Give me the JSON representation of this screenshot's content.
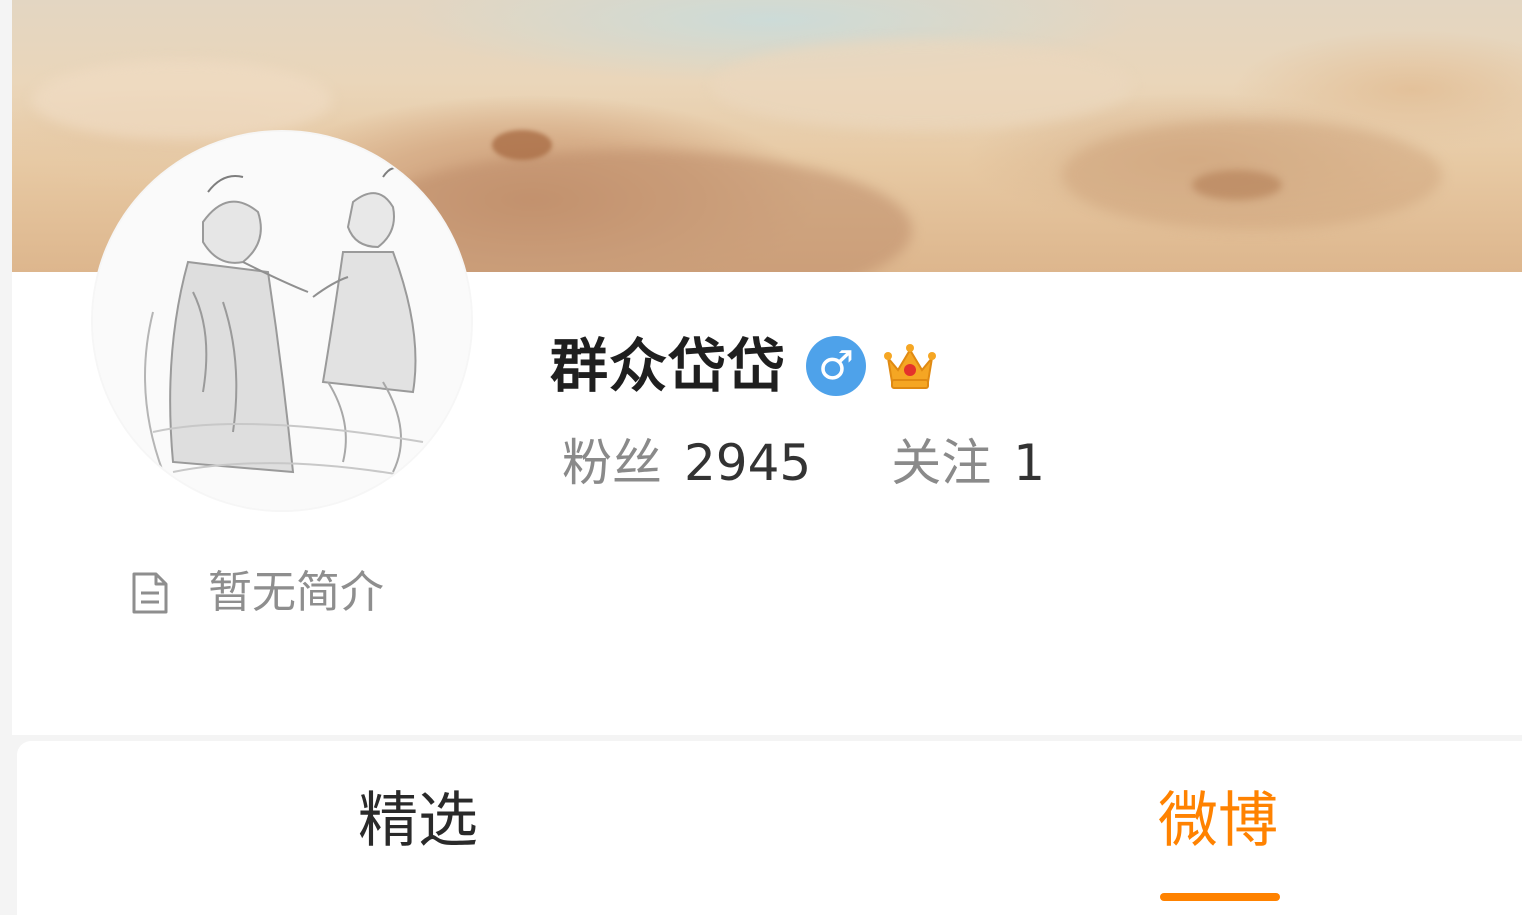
{
  "profile": {
    "name": "群众岱岱",
    "gender_symbol": "♂",
    "badges": [
      "gender-male-icon",
      "crown-icon"
    ],
    "stats": {
      "followers_label": "粉丝",
      "followers_value": "2945",
      "following_label": "关注",
      "following_value": "1"
    },
    "bio_icon": "document-icon",
    "bio": "暂无简介"
  },
  "tabs": [
    {
      "label": "精选",
      "active": false
    },
    {
      "label": "微博",
      "active": true
    }
  ],
  "colors": {
    "accent": "#ff8200",
    "gender_badge": "#4ea2ea",
    "crown": "#f5a623"
  }
}
